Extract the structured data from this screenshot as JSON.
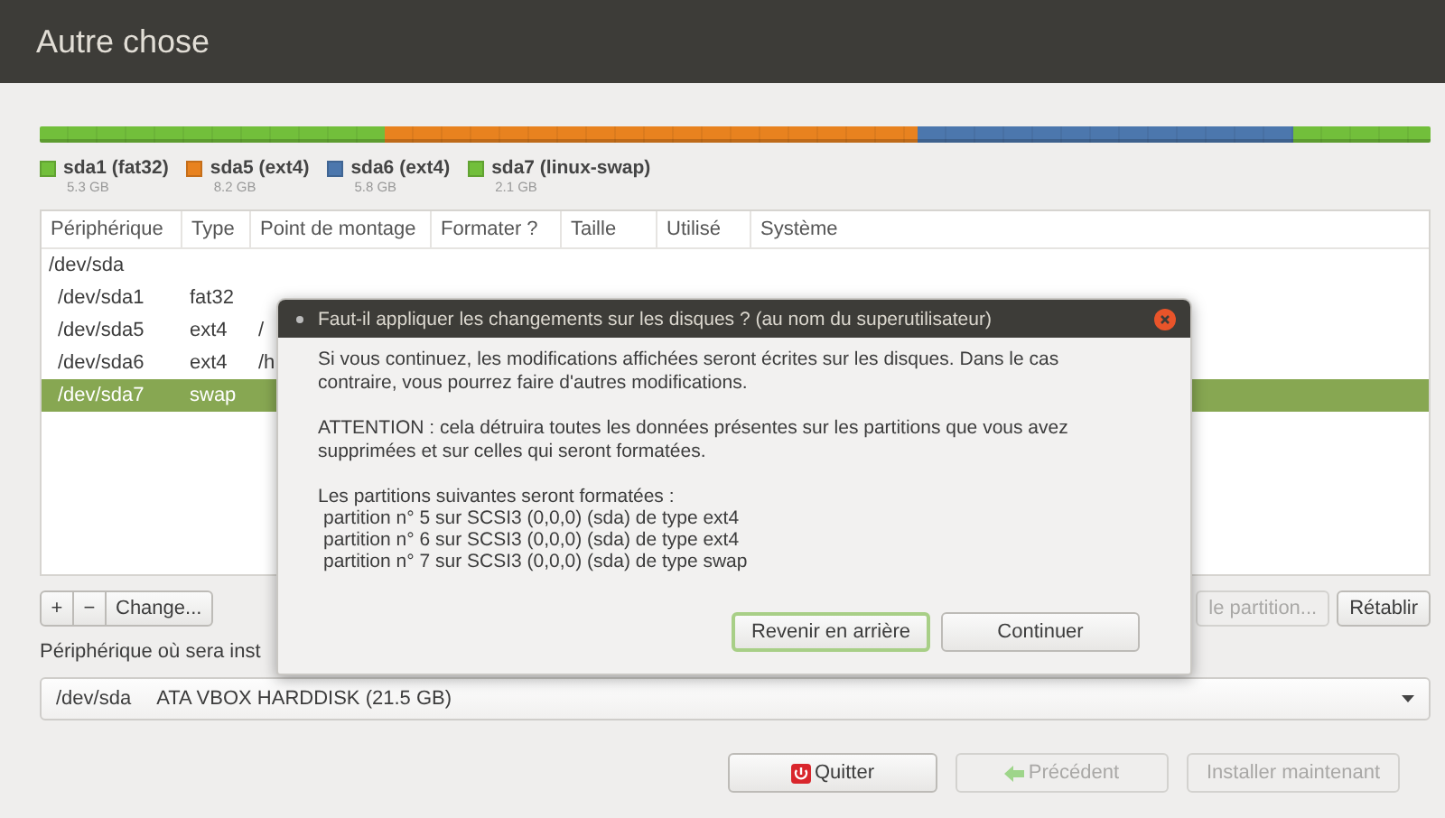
{
  "window": {
    "title": "Autre chose"
  },
  "partitions": [
    {
      "name": "sda1 (fat32)",
      "size": "5.3 GB",
      "color": "#72bf3b"
    },
    {
      "name": "sda5 (ext4)",
      "size": "8.2 GB",
      "color": "#e8821f"
    },
    {
      "name": "sda6 (ext4)",
      "size": "5.8 GB",
      "color": "#4c77ad"
    },
    {
      "name": "sda7 (linux-swap)",
      "size": "2.1 GB",
      "color": "#72bf3b"
    }
  ],
  "table": {
    "columns": [
      "Périphérique",
      "Type",
      "Point de montage",
      "Formater ?",
      "Taille",
      "Utilisé",
      "Système"
    ],
    "rows": [
      {
        "device": "/dev/sda",
        "selected": false,
        "children": [
          {
            "device": "/dev/sda1",
            "type": "fat32",
            "selected": false
          },
          {
            "device": "/dev/sda5",
            "type": "ext4",
            "mount": "/",
            "selected": false
          },
          {
            "device": "/dev/sda6",
            "type": "ext4",
            "mount": "/h",
            "selected": false
          },
          {
            "device": "/dev/sda7",
            "type": "swap",
            "selected": true
          }
        ]
      }
    ]
  },
  "partition_buttons": [
    {
      "label": "+",
      "kind": "add"
    },
    {
      "label": "−",
      "kind": "remove"
    },
    {
      "label": "Change...",
      "kind": "change"
    }
  ],
  "partition_actions": [
    {
      "label": "le partition...",
      "disabled": true
    },
    {
      "label": "Rétablir",
      "disabled": false
    }
  ],
  "boot_device": {
    "label": "Périphérique où sera inst",
    "device": "/dev/sda",
    "description": "ATA VBOX HARDDISK (21.5 GB)"
  },
  "footer_buttons": [
    {
      "label": "Quitter",
      "kind": "quit",
      "disabled": false
    },
    {
      "label": "Précédent",
      "kind": "back",
      "disabled": true
    },
    {
      "label": "Installer maintenant",
      "kind": "install",
      "disabled": true
    }
  ],
  "dialog": {
    "title": "Faut-il appliquer les changements sur les disques ? (au nom du superutilisateur)",
    "paragraphs": [
      "Si vous continuez, les modifications affichées seront écrites sur les disques. Dans le cas contraire, vous pourrez faire d'autres modifications.",
      "ATTENTION : cela détruira toutes les données présentes sur les partitions que vous avez supprimées et sur celles qui seront formatées."
    ],
    "list_heading": "Les partitions suivantes seront formatées :",
    "items": [
      "partition n° 5 sur SCSI3 (0,0,0) (sda) de type ext4",
      "partition n° 6 sur SCSI3 (0,0,0) (sda) de type ext4",
      "partition n° 7 sur SCSI3 (0,0,0) (sda) de type swap"
    ],
    "buttons": [
      {
        "label": "Revenir en arrière",
        "focused": true
      },
      {
        "label": "Continuer",
        "focused": false
      }
    ]
  }
}
